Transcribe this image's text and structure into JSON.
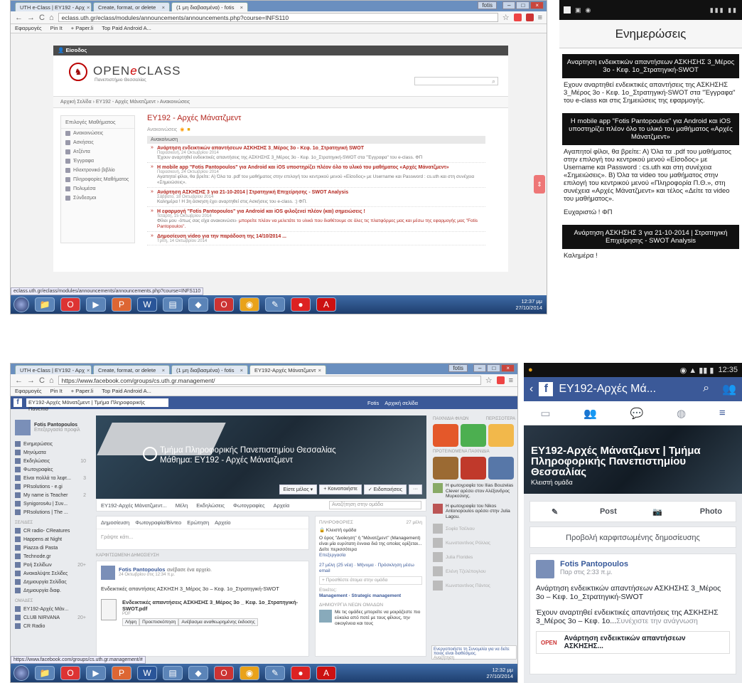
{
  "eclass": {
    "tabs": [
      "UTH e-Class | ΕΥ192 - Αρχ",
      "Create, format, or delete",
      "(1 μη διαβασμένα) - fotis"
    ],
    "user": "fotis",
    "url": "eclass.uth.gr/eclass/modules/announcements/announcements.php?course=INFS110",
    "bookmarks": [
      "Εφαρμογές",
      "Pin It",
      "+ Paper.li",
      "Top Paid Android A..."
    ],
    "login": "Είσοδος",
    "brand_a": "OPEN",
    "brand_e": "e",
    "brand_b": "CLASS",
    "brand_sub": "Πανεπιστήμιο Θεσσαλίας",
    "breadcrumb": "Αρχική Σελίδα › ΕΥ192 - Αρχές Μάνατζμεντ › Ανακοινώσεις",
    "sidebar_title": "Επιλογές Μαθήματος",
    "sidebar": [
      "Ανακοινώσεις",
      "Ασκήσεις",
      "Ατζέντα",
      "Έγγραφα",
      "Ηλεκτρονικό βιβλίο",
      "Πληροφορίες Μαθήματος",
      "Πολυμέσα",
      "Σύνδεσμοι"
    ],
    "course_title": "ΕΥ192 - Αρχές Μάνατζμεντ",
    "ann_link": "Ανακοινώσεις",
    "ann_bar": "Ανακοίνωση",
    "items": [
      {
        "title": "Ανάρτηση ενδεικτικών απαντήσεων ΑΣΚΗΣΗΣ 3_Μέρος 3ο - Κεφ. 1ο_Στρατηγική SWOT",
        "date": "Παρασκευή, 24 Οκτωβρίου 2014",
        "text": "Έχουν αναρτηθεί ενδεικτικές απαντήσεις της ΑΣΚΗΣΗΣ 3_Μέρος 3ο - Κεφ. 1ο_Στρατηγική-SWOT στα \"Έγγραφα\" του e-class. ΦΠ",
        "hl": ""
      },
      {
        "title": "Η mobile app \"Fotis Pantopoulos\" για Android και iOS υποστηρίζει πλέον όλο το υλικό του μαθήματος «Αρχές Μάνατζμεντ»",
        "date": "Παρασκευή, 24 Οκτωβρίου 2014",
        "text": "Αγαπητοί φίλοι, θα βρείτε: Α) Όλα τα .pdf του μαθήματος στην επιλογή του κεντρικού μενού «Είσοδος» με Username και Password : cs.uth και στη συνέχεια «Σημειώσεις».",
        "hl": ""
      },
      {
        "title": "Ανάρτηση ΑΣΚΗΣΗΣ 3 για 21-10-2014 | Στρατηγική Επιχείρησης - SWOT Analysis",
        "date": "Σάββατο, 18 Οκτωβρίου 2014",
        "text": "Καλημέρα ! Η 3η άσκηση έχει αναρτηθεί στις Ασκήσεις του e-class. :) ΦΠ.",
        "hl": ""
      },
      {
        "title": "Η εφαρμογή \"Fotis Pantopoulos\" για Android και iOS φιλοξενεί πλέον (και) σημειώσεις !",
        "date": "Τετάρτη, 15 Οκτωβρίου 2014",
        "text": "Φίλοι μου -όπως σας είχα ανακοινώσει-",
        "hl": "μπορείτε πλέον να μελετάτε το υλικό που διαθέτουμε σε όλες τις πλατφόρμες μας και μέσω της εφαρμογής μας \"Fotis Pantopoulos\"."
      },
      {
        "title": "Δημοσίευση video για την παράδοση της 14/10/2014 ...",
        "date": "Τρίτη, 14 Οκτωβρίου 2014",
        "text": "",
        "hl": ""
      }
    ],
    "status_url": "eclass.uth.gr/eclass/modules/announcements/announcements.php?course=INFS110",
    "clock_time": "12:37 μμ",
    "clock_date": "27/10/2014"
  },
  "phone1": {
    "title": "Ενημερώσεις",
    "b1": "Αναρτηση ενδεικτικών απαντήσεων ΑΣΚΗΣΗΣ 3_Μέρος 3ο - Κεφ. 1ο_Στρατηγική-SWOT",
    "t1": "Εχουν αναρτηθεί ενδεικτικές απαντήσεις της ΑΣΚΗΣΗΣ 3_Μέρος 3ο - Κεφ. 1ο_Στρατηγική-SWOT στα \"Έγγραφα\" του e-class και στις Σημειώσεις της εφαρμογής.",
    "b2": "Η mobile app \"Fotis Pantopoulos\" για Android και iOS υποστηρίζει πλέον όλο το υλικό του μαθήματος «Αρχές Μάνατζμεντ»",
    "t2": "Αγαπητοί φίλοι, θα βρείτε: Α) Όλα τα .pdf του μαθήματος στην επιλογή του κεντρικού μενού «Είσοδος» με Username και Password : cs.uth και στη συνέχεια «Σημειώσεις». Β) Όλα τα video του μαθήματος στην επιλογή του κεντρικού μενού «Πληροφορία Π.Θ.», στη συνέχεια «Αρχές Μάνατζμεντ» και τέλος «Δείτε τα video του μαθήματος».",
    "t3": "Ευχαριστώ ! ΦΠ",
    "b3": "Ανάρτηση ΑΣΚΗΣΗΣ 3 για 21-10-2014 | Στρατηγική Επιχείρησης - SWOT Analysis",
    "t4": "Καλημέρα !"
  },
  "fb": {
    "tabs": [
      "UTH e-Class | ΕΥ192 - Αρχ",
      "Create, format, or delete",
      "(1 μη διαβασμένα) - fotis",
      "ΕΥ192-Αρχές Μάνατζμεντ"
    ],
    "url": "https://www.facebook.com/groups/cs.uth.gr.management/",
    "search": "ΕΥ192-Αρχές Μάνατζμεντ | Τμήμα Πληροφορικής Πανεπισ",
    "user": "Fotis",
    "home": "Αρχική σελίδα",
    "profile": "Fotis Pantopoulos",
    "profile_sub": "Επεξεργασία προφίλ",
    "left": [
      {
        "label": "Ενημερώσεις",
        "count": ""
      },
      {
        "label": "Μηνύματα",
        "count": ""
      },
      {
        "label": "Εκδηλώσεις",
        "count": "10"
      },
      {
        "label": "Φωτογραφίες",
        "count": ""
      },
      {
        "label": "Είναι πολλά τα λεφτ...",
        "count": "3"
      },
      {
        "label": "PRsolutions - e.gi",
        "count": ""
      },
      {
        "label": "My name is Teacher",
        "count": "2"
      },
      {
        "label": "Synigoros4u | Συν...",
        "count": ""
      },
      {
        "label": "PRsolutions | The ...",
        "count": ""
      }
    ],
    "pages_hd": "ΣΕΛΙΔΕΣ",
    "pages": [
      {
        "label": "CR radio- CReatures",
        "count": ""
      },
      {
        "label": "Happens at Night",
        "count": ""
      },
      {
        "label": "Piazza di Pasta",
        "count": ""
      },
      {
        "label": "Technode.gr",
        "count": ""
      },
      {
        "label": "Ροή Σελίδων",
        "count": "20+"
      },
      {
        "label": "Ανακαλύψτε Σελίδες",
        "count": ""
      },
      {
        "label": "Δημιουργία Σελίδας",
        "count": ""
      },
      {
        "label": "Δημιουργία διαφ.",
        "count": ""
      }
    ],
    "groups_hd": "ΟΜΑΔΕΣ",
    "groups": [
      {
        "label": "ΕΥ192-Αρχές Μάν...",
        "count": ""
      },
      {
        "label": "CLUB NIRVANA",
        "count": "20+"
      },
      {
        "label": "CR Radio",
        "count": ""
      }
    ],
    "cover_line1": "Τμήμα Πληροφορικής Πανεπιστημίου Θεσσαλίας",
    "cover_line2": "Μάθημα: ΕΥ192 - Αρχές Μάνατζμεντ",
    "join": [
      "Είστε μέλος ▾",
      "+ Κοινοποιήστε",
      "✓ Ειδοποιήσεις",
      "···"
    ],
    "grp_tabs": [
      "ΕΥ192-Αρχές Μάνατζμεντ...",
      "Μέλη",
      "Εκδηλώσεις",
      "Φωτογραφίες",
      "Αρχεία"
    ],
    "grp_search": "Αναζήτηση στην ομάδα",
    "comp_tabs": [
      "Δημοσίευση",
      "Φωτογραφία/Βίντεο",
      "Ερώτηση",
      "Αρχείο"
    ],
    "comp_ph": "Γράψτε κάτι...",
    "pinned_hd": "ΚΑΡΦΙΤΣΩΜΕΝΗ ΔΗΜΟΣΙΕΥΣΗ",
    "post_name": "Fotis Pantopoulos",
    "post_verb": "ανέβασε ένα αρχείο.",
    "post_time": "24 Οκτωβρίου στις 12:34 π.μ.",
    "post_body": "Ενδεικτικές απαντήσεις ΑΣΚΗΣΗ 3_Μέρος 3ο – Κεφ. 1ο_Στρατηγική-SWOT",
    "att_title": "Ενδεικτικές απαντήσεις ΑΣΚΗΣΗΣ 3_Μέρος 3ο _ Κεφ. 1ο_Στρατηγική-SWOT.pdf",
    "att_type": "PDF",
    "att_actions": [
      "Λήψη",
      "Προεπισκόπηση",
      "Ανέβασμα αναθεωρημένης έκδοσης"
    ],
    "about_hd": "ΠΛΗΡΟΦΟΡΙΕΣ",
    "about_members": "27 μέλη",
    "about_closed": "Κλειστή ομάδα",
    "about_text": "Ο όρος \"Διοίκηση\" ή \"Μάνατζμεντ\" (Management) είναι μία ευρύτατη έννοια διά της οποίας ορίζεται... Δείτε περισσότερα",
    "about_edit": "Επεξεργασία",
    "about_tags": "27 μέλη (25 νέα) · Μήνυμα · Πρόσκληση μέσω email",
    "about_add": "+ Προσθέστε άτομα στην ομάδα",
    "about_tags_hd": "Ετικέτες:",
    "about_tags_val": "Management · Strategic management",
    "about_sugg": "ΔΗΜΙΟΥΡΓΙΑ ΝΕΩΝ ΟΜΑΔΩΝ",
    "about_sugg_txt": "Με τις ομάδες μπορείτε να μοιράζεστε πιο εύκολα από ποτέ με τους φίλους, την οικογένεια και τους",
    "right_hd1": "ΠΑΙΧΝΙΔΙΑ ΦΙΛΩΝ",
    "right_hd1b": "ΠΕΡΙΣΣΟΤΕΡΑ",
    "right_hd2": "ΠΡΟΤΕΙΝΟΜΕΝΑ ΠΑΙΧΝΙΔΙΑ",
    "right_news": [
      "Η φωτογραφία του Ilias Bouzelas Clever αρέσει στον Αλέξανδρος Mυρκούνης.",
      "Η φωτογραφία του Nikos Antonopoulos αρέσει στην Julia Lagou."
    ],
    "friends": [
      "Σοφία Τσέλιου",
      "Κωνσταντίνος Ρόλλας",
      "Julia Florides",
      "Ελένη Τζελέπογλου",
      "Κωνσταντίνος Πάντος"
    ],
    "chat": "Ενεργοποιήστε τη Συνομιλία για να δείτε ποιος είναι διαθέσιμος.",
    "chat_search": "Αναζήτηση",
    "status_url": "https://www.facebook.com/groups/cs.uth.gr.management/#",
    "clock_time": "12:32 μμ",
    "clock_date": "27/10/2014"
  },
  "phone2": {
    "time": "12:35",
    "title": "ΕΥ192-Αρχές Μά...",
    "cover_title": "ΕΥ192-Αρχές Μάνατζμεντ | Τμήμα Πληροφορικής Πανεπιστημίου Θεσσαλίας",
    "cover_sub": "Κλειστή ομάδα",
    "post_btn": "Post",
    "photo_btn": "Photo",
    "pinned": "Προβολή καρφιτσωμένης δημοσίευσης",
    "name": "Fotis Pantopoulos",
    "time_ago": "Παρ στις 2:33 π.μ.",
    "b1": "Ανάρτηση ενδεικτικών απαντήσεων ΑΣΚΗΣΗΣ 3_Μέρος 3ο – Κεφ. 1ο_Στρατηγική-SWOT",
    "b2": "Έχουν αναρτηθεί ενδεικτικές απαντήσεις της ΑΣΚΗΣΗΣ 3_Μέρος 3ο – Κεφ. 1ο...",
    "cont": "Συνέχιστε την ανάγνωση",
    "card_logo": "OPEN",
    "card_title": "Ανάρτηση ενδεικτικών απαντήσεων ΑΣΚΗΣΗΣ..."
  }
}
